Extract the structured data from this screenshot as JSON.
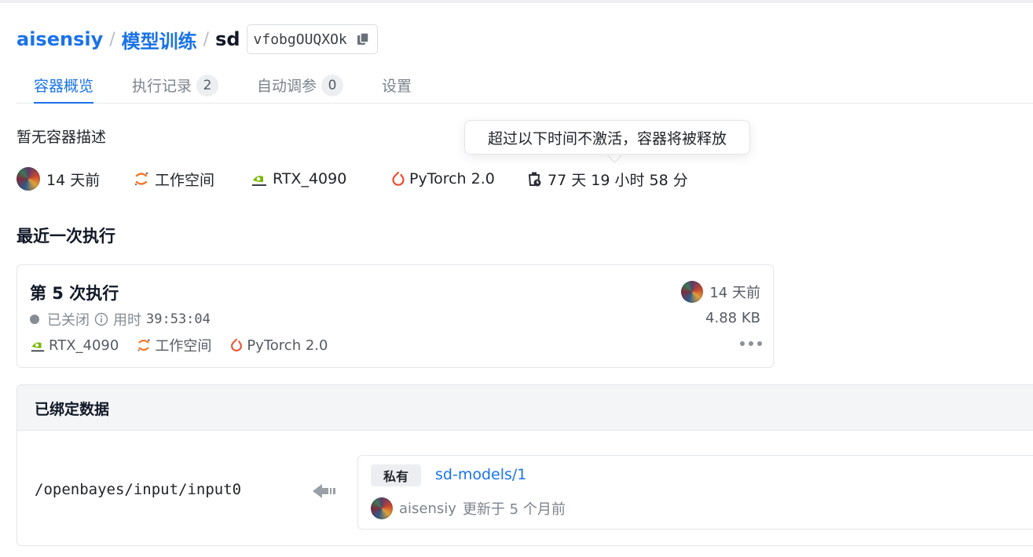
{
  "breadcrumb": {
    "user": "aisensiy",
    "separator": "/",
    "project": "模型训练",
    "container": "sd",
    "container_id": "vfobgOUQXOk"
  },
  "tabs": [
    {
      "label": "容器概览",
      "active": true
    },
    {
      "label": "执行记录",
      "badge": "2"
    },
    {
      "label": "自动调参",
      "badge": "0"
    },
    {
      "label": "设置"
    }
  ],
  "overview": {
    "description": "暂无容器描述",
    "tooltip": "超过以下时间不激活，容器将被释放",
    "created": "14 天前",
    "workspace": "工作空间",
    "gpu": "RTX_4090",
    "framework": "PyTorch 2.0",
    "release_countdown": "77 天 19 小时 58 分"
  },
  "latest_run": {
    "section_title": "最近一次执行",
    "title": "第 5 次执行",
    "status": "已关闭",
    "duration_label": "用时",
    "duration": "39:53:04",
    "gpu": "RTX_4090",
    "workspace": "工作空间",
    "framework": "PyTorch 2.0",
    "created": "14 天前",
    "size": "4.88 KB"
  },
  "bound_data": {
    "title": "已绑定数据",
    "mount_path": "/openbayes/input/input0",
    "visibility": "私有",
    "dataset": "sd-models/1",
    "owner": "aisensiy",
    "updated": "更新于 5 个月前"
  },
  "colors": {
    "accent": "#1a73e8",
    "muted": "#7c838c",
    "nvidia": "#76b900",
    "pytorch": "#ee4c2c",
    "jupyter": "#f37726"
  },
  "icons": [
    "copy-icon",
    "avatar",
    "jupyter-icon",
    "nvidia-icon",
    "pytorch-icon",
    "timer-icon",
    "info-icon",
    "more-icon",
    "bind-arrow-icon"
  ]
}
